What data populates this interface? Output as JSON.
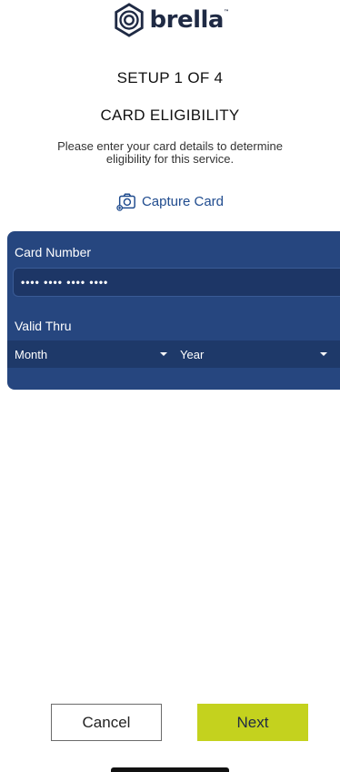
{
  "brand": {
    "name": "brella",
    "trademark": "™",
    "logo_icon": "brella-logo-icon"
  },
  "setup": {
    "step": "SETUP 1 OF 4",
    "section": "CARD ELIGIBILITY",
    "instructions": "Please enter your card details to determine eligibility for this service."
  },
  "capture": {
    "label": "Capture Card",
    "icon": "camera-icon"
  },
  "card": {
    "number_label": "Card Number",
    "number_value": "••••  ••••  ••••  ••••",
    "valid_label": "Valid Thru",
    "month_selected": "Month",
    "year_selected": "Year"
  },
  "actions": {
    "cancel": "Cancel",
    "next": "Next"
  },
  "colors": {
    "panel": "#26467f",
    "accent_link": "#1f4b8e",
    "next_button": "#c4d21e"
  }
}
